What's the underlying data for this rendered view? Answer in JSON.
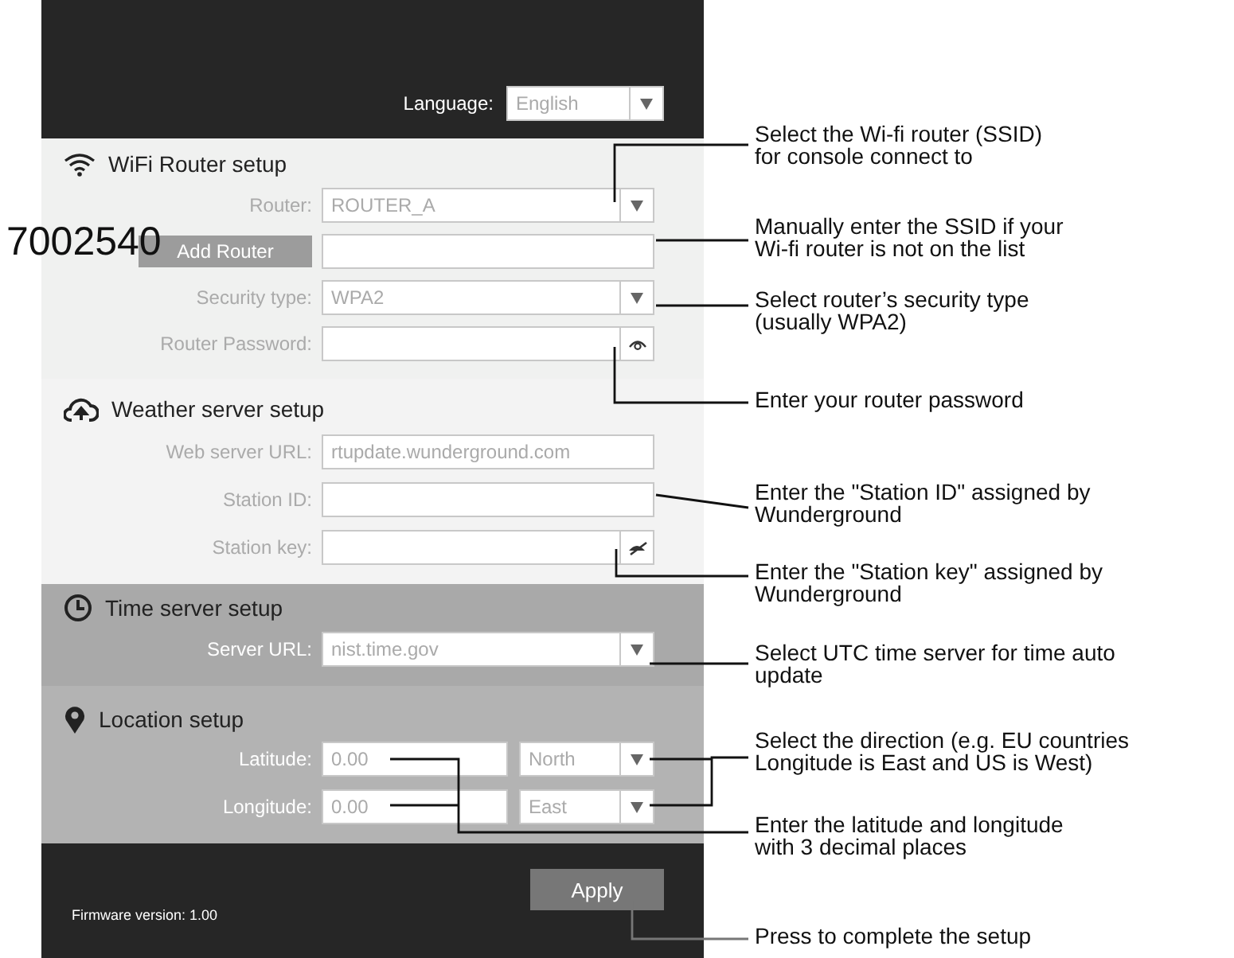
{
  "figure_number": "7002540",
  "header": {
    "language_label": "Language:",
    "language_value": "English"
  },
  "sections": [
    {
      "kind": "wifi",
      "title": "WiFi Router setup",
      "rows": [
        {
          "kind": "select",
          "label": "Router:",
          "value": "ROUTER_A"
        },
        {
          "kind": "button-field",
          "button": "Add Router"
        },
        {
          "kind": "select",
          "label": "Security type:",
          "value": "WPA2"
        },
        {
          "kind": "secret",
          "label": "Router Password:",
          "visible": true
        }
      ]
    },
    {
      "kind": "weather",
      "title": "Weather server setup",
      "rows": [
        {
          "kind": "field",
          "label": "Web server URL:",
          "value": "rtupdate.wunderground.com"
        },
        {
          "kind": "field",
          "label": "Station ID:"
        },
        {
          "kind": "secret",
          "label": "Station key:",
          "visible": false
        }
      ]
    },
    {
      "kind": "time",
      "title": "Time server setup",
      "rows": [
        {
          "kind": "select",
          "label": "Server URL:",
          "value": "nist.time.gov"
        }
      ]
    },
    {
      "kind": "location",
      "title": "Location setup",
      "rows": [
        {
          "kind": "coord",
          "label": "Latitude:",
          "value": "0.00",
          "direction": "North"
        },
        {
          "kind": "coord",
          "label": "Longitude:",
          "value": "0.00",
          "direction": "East"
        }
      ]
    }
  ],
  "footer": {
    "firmware": "Firmware version: 1.00",
    "apply": "Apply"
  },
  "annotations": [
    {
      "lines": [
        "Select the Wi-fi router (SSID)",
        "for console connect to"
      ]
    },
    {
      "lines": [
        "Manually enter the SSID if your",
        "Wi-fi router is not on the list"
      ]
    },
    {
      "lines": [
        "Select router’s security type",
        "(usually WPA2)"
      ]
    },
    {
      "lines": [
        "Enter your router password"
      ]
    },
    {
      "lines": [
        "Enter the \"Station ID\" assigned by",
        "Wunderground"
      ]
    },
    {
      "lines": [
        "Enter the \"Station key\" assigned by",
        "Wunderground"
      ]
    },
    {
      "lines": [
        "Select UTC time server for time auto",
        "update"
      ]
    },
    {
      "lines": [
        "Select the direction (e.g. EU countries",
        "Longitude is East and US is West)"
      ]
    },
    {
      "lines": [
        "Enter the latitude and longitude",
        "with 3 decimal places"
      ]
    },
    {
      "lines": [
        "Press to complete the setup"
      ]
    }
  ]
}
